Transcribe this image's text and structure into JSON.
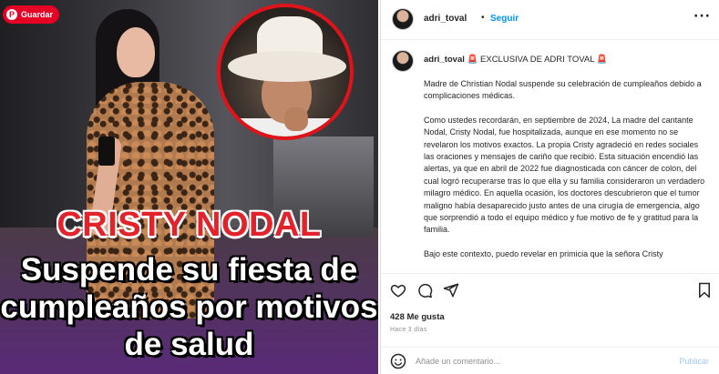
{
  "media": {
    "save_label": "Guardar",
    "headline_name": "CRISTY NODAL",
    "headline_line1": "Suspende su fiesta de",
    "headline_line2": "cumpleaños por motivos",
    "headline_line3": "de salud"
  },
  "header": {
    "username": "adri_toval",
    "separator": "•",
    "follow_label": "Seguir",
    "more_icon": "more-horizontal-icon"
  },
  "caption": {
    "username": "adri_toval",
    "badge": "🚨",
    "title": "EXCLUSIVA DE ADRI TOVAL",
    "paragraph1": "Madre de Christian Nodal suspende su celebración de cumpleaños debido a complicaciones médicas.",
    "paragraph2": "Como ustedes recordarán, en septiembre de 2024, La madre del cantante Nodal, Cristy Nodal, fue hospitalizada, aunque en ese momento no se revelaron los motivos exactos. La propia Cristy agradeció en redes sociales las oraciones y mensajes de cariño que recibió. Esta situación encendió las alertas, ya que en abril de 2022 fue diagnosticada con cáncer de colon, del cual logró recuperarse tras lo que ella y su familia consideraron un verdadero milagro médico. En aquella ocasión, los doctores descubrieron que el tumor maligno había desaparecido justo antes de una cirugía de emergencia, algo que sorprendió a todo el equipo médico y fue motivo de fe y gratitud para la familia.",
    "paragraph3": "Bajo este contexto, puedo revelar en primicia que la señora Cristy"
  },
  "actions": {
    "like_icon": "heart-icon",
    "comment_icon": "comment-icon",
    "share_icon": "send-icon",
    "save_icon": "bookmark-icon",
    "likes": "428 Me gusta",
    "time": "Hace 3 días"
  },
  "comment": {
    "emoji_icon": "emoji-icon",
    "placeholder": "Añade un comentario...",
    "publish_label": "Publicar"
  }
}
